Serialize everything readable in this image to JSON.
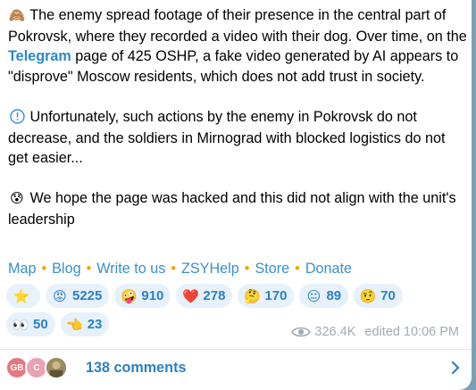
{
  "post": {
    "paragraphs": [
      {
        "icon": "monkey-icon",
        "glyph": "🙈",
        "text_before": "The enemy spread footage of their presence in the central part of Pokrovsk, where they recorded a video with their dog. Over time, on the ",
        "link": "Telegram",
        "text_after": " page of 425 OSHP, a fake video generated by AI appears to \"disprove\" Moscow residents, which does not add trust in society."
      },
      {
        "icon": "info-icon",
        "glyph": "ⓘ",
        "text": "Unfortunately, such actions by the enemy in Pokrovsk do not decrease, and the soldiers in Mirnograd with blocked logistics do not get easier..."
      },
      {
        "icon": "anxious-face-icon",
        "glyph": "😰",
        "text": "We hope the page was hacked and this did not align with the unit's leadership"
      }
    ]
  },
  "links": [
    "Map",
    "Blog",
    "Write to us",
    "ZSYHelp",
    "Store",
    "Donate"
  ],
  "link_separator": "•",
  "reactions": {
    "row1": [
      {
        "icon": "star-icon",
        "glyph": "⭐",
        "count": ""
      },
      {
        "icon": "angry-face-icon",
        "glyph": "😡",
        "count": "5225"
      },
      {
        "icon": "zany-face-icon",
        "glyph": "🤪",
        "count": "910"
      },
      {
        "icon": "heart-icon",
        "glyph": "❤️",
        "count": "278"
      },
      {
        "icon": "thinking-face-icon",
        "glyph": "🤔",
        "count": "170"
      },
      {
        "icon": "neutral-face-icon",
        "glyph": "😐",
        "count": "89"
      },
      {
        "icon": "raised-eyebrow-face-icon",
        "glyph": "🤨",
        "count": "70"
      }
    ],
    "row2": [
      {
        "icon": "eyes-icon",
        "glyph": "👀",
        "count": "50"
      },
      {
        "icon": "pointing-hand-icon",
        "glyph": "👈",
        "count": "23"
      }
    ]
  },
  "meta": {
    "views": "326.4K",
    "edited": "edited 10:06 PM"
  },
  "comments": {
    "avatars": [
      "GB",
      "C",
      ""
    ],
    "label": "138 comments"
  },
  "colors": {
    "accent": "#2a7fc6",
    "link": "#3a8fcf",
    "separator": "#f0a500",
    "chip_bg": "#e6f1fb",
    "meta": "#a2acb4"
  }
}
